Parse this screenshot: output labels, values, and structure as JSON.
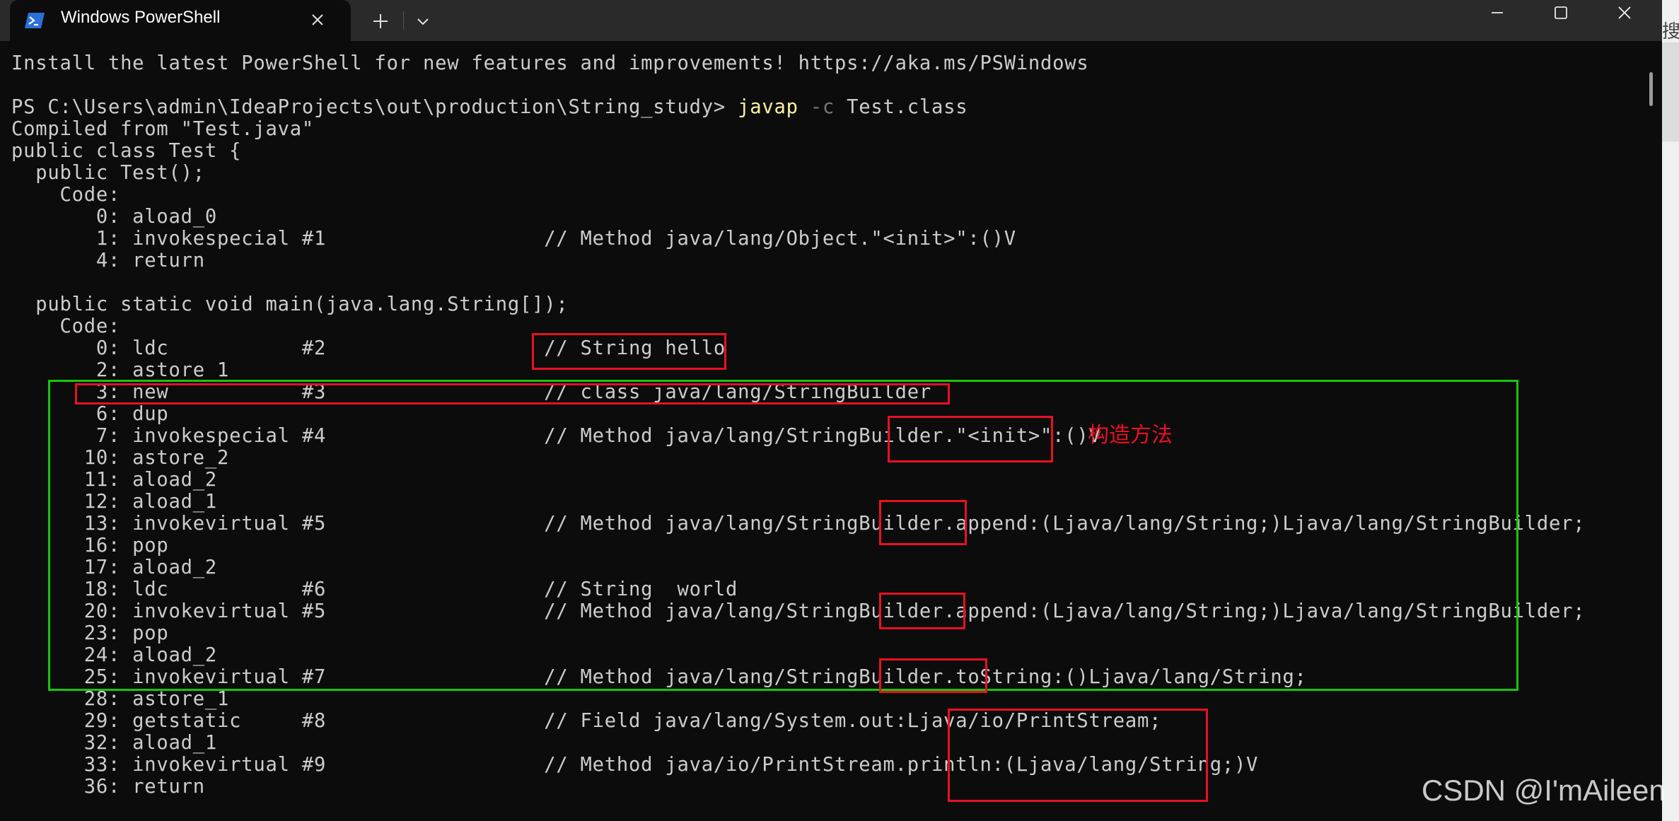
{
  "window": {
    "tab_title": "Windows PowerShell"
  },
  "terminal": {
    "banner": "Install the latest PowerShell for new features and improvements! https://aka.ms/PSWindows",
    "prompt": "PS C:\\Users\\admin\\IdeaProjects\\out\\production\\String_study> ",
    "command": {
      "name": "javap",
      "flag": " -c",
      "args": " Test.class"
    },
    "output": [
      "Compiled from \"Test.java\"",
      "public class Test {",
      "  public Test();",
      "    Code:",
      "       0: aload_0",
      "       1: invokespecial #1                  // Method java/lang/Object.\"<init>\":()V",
      "       4: return",
      "",
      "  public static void main(java.lang.String[]);",
      "    Code:",
      "       0: ldc           #2                  // String hello",
      "       2: astore_1",
      "       3: new           #3                  // class java/lang/StringBuilder",
      "       6: dup",
      "       7: invokespecial #4                  // Method java/lang/StringBuilder.\"<init>\":()V",
      "      10: astore_2",
      "      11: aload_2",
      "      12: aload_1",
      "      13: invokevirtual #5                  // Method java/lang/StringBuilder.append:(Ljava/lang/String;)Ljava/lang/StringBuilder;",
      "      16: pop",
      "      17: aload_2",
      "      18: ldc           #6                  // String  world",
      "      20: invokevirtual #5                  // Method java/lang/StringBuilder.append:(Ljava/lang/String;)Ljava/lang/StringBuilder;",
      "      23: pop",
      "      24: aload_2",
      "      25: invokevirtual #7                  // Method java/lang/StringBuilder.toString:()Ljava/lang/String;",
      "      28: astore_1",
      "      29: getstatic     #8                  // Field java/lang/System.out:Ljava/io/PrintStream;",
      "      32: aload_1",
      "      33: invokevirtual #9                  // Method java/io/PrintStream.println:(Ljava/lang/String;)V",
      "      36: return"
    ]
  },
  "annotation": {
    "label": "构造方法"
  },
  "watermark": "CSDN @I'mAileen",
  "right_edge_char": "搜",
  "colors": {
    "background": "#0c0c0c",
    "text": "#cccccc",
    "command": "#f9f1a5",
    "flag": "#767676",
    "annotation_red": "#e81123",
    "annotation_green": "#16c60c"
  },
  "icons": [
    "powershell-icon",
    "close-icon",
    "plus-icon",
    "chevron-down-icon",
    "minimize-icon",
    "maximize-icon",
    "close-window-icon"
  ]
}
